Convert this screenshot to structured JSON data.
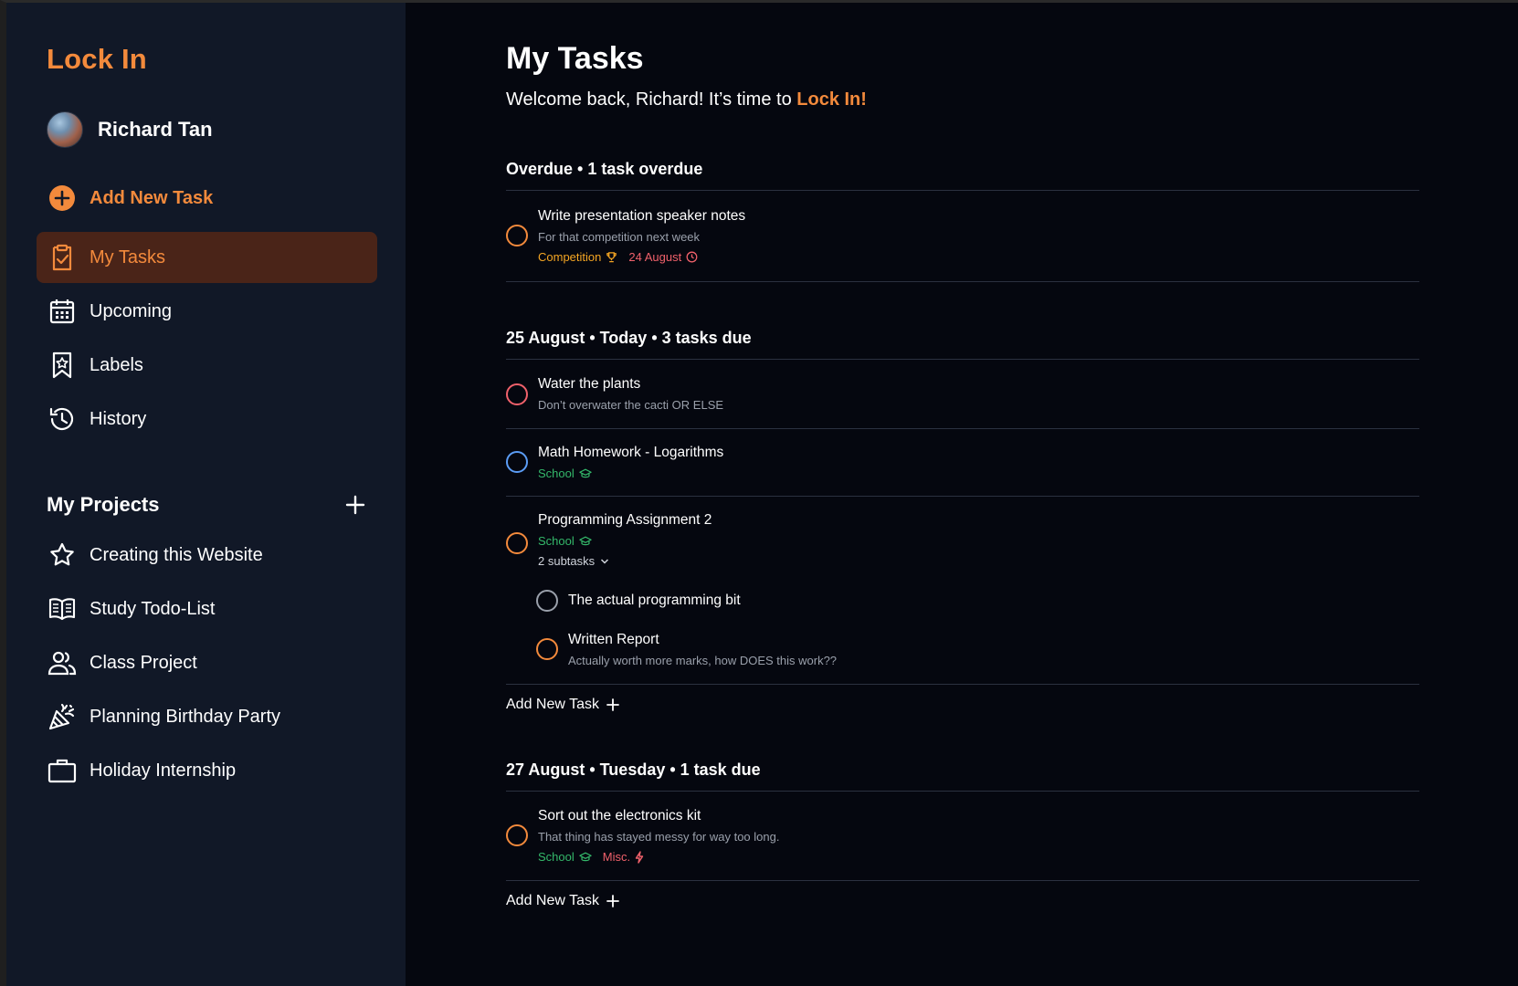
{
  "app": {
    "brand": "Lock In"
  },
  "user": {
    "name": "Richard Tan"
  },
  "sidebar": {
    "add_task": "Add New Task",
    "nav": [
      {
        "label": "My Tasks",
        "icon": "clipboard-check-icon",
        "active": true
      },
      {
        "label": "Upcoming",
        "icon": "calendar-icon"
      },
      {
        "label": "Labels",
        "icon": "bookmark-star-icon"
      },
      {
        "label": "History",
        "icon": "history-icon"
      }
    ],
    "projects_title": "My Projects",
    "projects": [
      {
        "label": "Creating this Website",
        "icon": "star-icon"
      },
      {
        "label": "Study Todo-List",
        "icon": "open-book-icon"
      },
      {
        "label": "Class Project",
        "icon": "users-icon"
      },
      {
        "label": "Planning Birthday Party",
        "icon": "party-popper-icon"
      },
      {
        "label": "Holiday Internship",
        "icon": "briefcase-icon"
      }
    ]
  },
  "main": {
    "title": "My Tasks",
    "welcome_prefix": "Welcome back, Richard! It’s time to ",
    "welcome_accent": "Lock In!",
    "sections": [
      {
        "heading": "Overdue • 1 task overdue",
        "tasks": [
          {
            "title": "Write presentation speaker notes",
            "description": "For that competition next week",
            "tags": [
              {
                "label": "Competition",
                "icon": "trophy-icon",
                "color": "#f5a623"
              },
              {
                "label": "24 August",
                "icon": "clock-icon",
                "color": "#f0616b"
              }
            ],
            "circle_color": "#f38a3c"
          }
        ]
      },
      {
        "heading": "25 August • Today • 3 tasks due",
        "tasks": [
          {
            "title": "Water the plants",
            "description": "Don’t overwater the cacti OR ELSE",
            "circle_color": "#f0616b"
          },
          {
            "title": "Math Homework - Logarithms",
            "tags": [
              {
                "label": "School",
                "icon": "graduation-cap-icon",
                "color": "#34b86a"
              }
            ],
            "circle_color": "#5b9cf5"
          },
          {
            "title": "Programming Assignment 2",
            "tags": [
              {
                "label": "School",
                "icon": "graduation-cap-icon",
                "color": "#34b86a"
              }
            ],
            "subtasks_label": "2 subtasks",
            "circle_color": "#f38a3c",
            "subtasks": [
              {
                "title": "The actual programming bit",
                "circle_color": "#9aa0ab"
              },
              {
                "title": "Written Report",
                "description": "Actually worth more marks, how DOES this work??",
                "circle_color": "#f38a3c"
              }
            ]
          }
        ],
        "add_task": "Add New Task"
      },
      {
        "heading": "27 August • Tuesday • 1 task due",
        "tasks": [
          {
            "title": "Sort out the electronics kit",
            "description": "That thing has stayed messy for way too long.",
            "tags": [
              {
                "label": "School",
                "icon": "graduation-cap-icon",
                "color": "#34b86a"
              },
              {
                "label": "Misc.",
                "icon": "lightning-icon",
                "color": "#f0616b"
              }
            ],
            "circle_color": "#f38a3c"
          }
        ],
        "add_task": "Add New Task"
      }
    ]
  },
  "colors": {
    "accent": "#f38a3c",
    "sidebar_bg": "#111827",
    "main_bg": "#05070f",
    "active_bg": "#4a2418"
  }
}
